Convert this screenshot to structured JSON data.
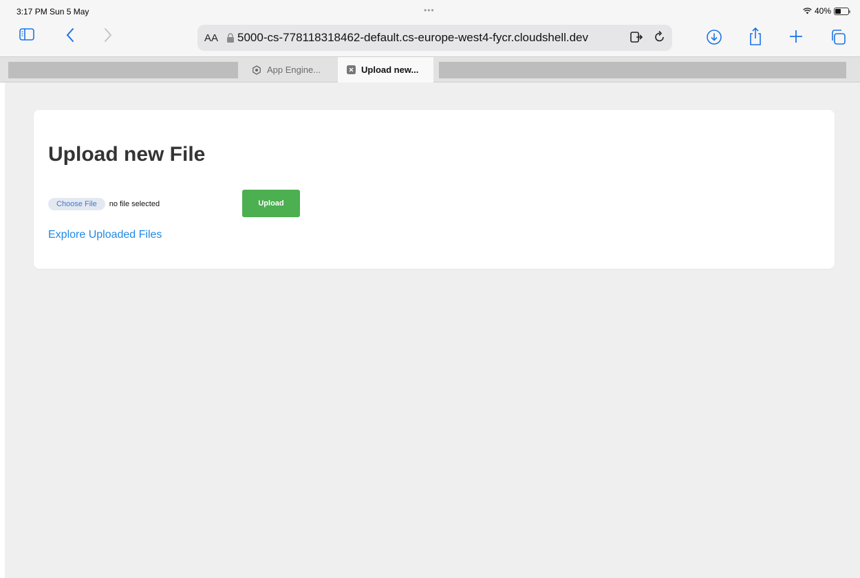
{
  "status": {
    "time": "3:17 PM  Sun 5 May",
    "dots": "•••",
    "battery": "40%"
  },
  "toolbar": {
    "aa_label": "AA",
    "url": "5000-cs-778118318462-default.cs-europe-west4-fycr.cloudshell.dev"
  },
  "tabs": [
    {
      "label": "App Engine...",
      "icon": "app-engine-icon",
      "active": false
    },
    {
      "label": "Upload new...",
      "icon": "close-tab-icon",
      "active": true
    }
  ],
  "page": {
    "title": "Upload new File",
    "choose_file_label": "Choose File",
    "file_status": "no file selected",
    "upload_label": "Upload",
    "explore_link": "Explore Uploaded Files"
  },
  "colors": {
    "accent": "#1a73e8",
    "upload_button": "#4caf50",
    "link": "#1e88e5",
    "page_background": "#efefef"
  }
}
